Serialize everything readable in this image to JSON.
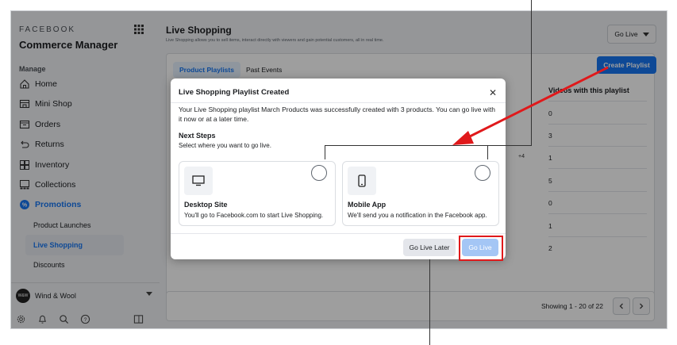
{
  "sidebar": {
    "brand_top": "FACEBOOK",
    "brand_title": "Commerce Manager",
    "section_label": "Manage",
    "items": [
      {
        "label": "Home",
        "icon": "home-icon"
      },
      {
        "label": "Mini Shop",
        "icon": "shop-icon"
      },
      {
        "label": "Orders",
        "icon": "orders-icon"
      },
      {
        "label": "Returns",
        "icon": "returns-icon"
      },
      {
        "label": "Inventory",
        "icon": "inventory-icon"
      },
      {
        "label": "Collections",
        "icon": "collections-icon"
      },
      {
        "label": "Promotions",
        "icon": "promotions-icon"
      }
    ],
    "sub_items": [
      "Product Launches",
      "Live Shopping",
      "Discounts"
    ],
    "shop_name": "Wind & Wool",
    "avatar_text": "W&W"
  },
  "header": {
    "title": "Live Shopping",
    "subtitle": "Live Shopping allows you to sell items, interact directly with viewers and gain potential customers, all in real time.",
    "go_live_label": "Go Live"
  },
  "tabs": [
    {
      "label": "Product Playlists",
      "active": true
    },
    {
      "label": "Past Events",
      "active": false
    }
  ],
  "create_playlist_label": "Create Playlist",
  "table": {
    "column_header": "Videos with this playlist",
    "values": [
      "0",
      "3",
      "1",
      "5",
      "0",
      "1",
      "2"
    ],
    "extra_badge": "+4"
  },
  "pagination": {
    "showing": "Showing 1 - 20 of 22"
  },
  "modal": {
    "title": "Live Shopping Playlist Created",
    "body": "Your Live Shopping playlist March Products was successfully created with 3 products. You can go live with it now or at a later time.",
    "next_steps_title": "Next Steps",
    "next_steps_sub": "Select where you want to go live.",
    "options": [
      {
        "title": "Desktop Site",
        "desc": "You'll go to Facebook.com to start Live Shopping.",
        "icon": "desktop-icon"
      },
      {
        "title": "Mobile App",
        "desc": "We'll send you a notification in the Facebook app.",
        "icon": "mobile-icon"
      }
    ],
    "go_live_later_label": "Go Live Later",
    "go_live_label": "Go Live"
  },
  "colors": {
    "accent": "#1877f2",
    "highlight": "#e0191b",
    "arrow": "#e0191b"
  }
}
